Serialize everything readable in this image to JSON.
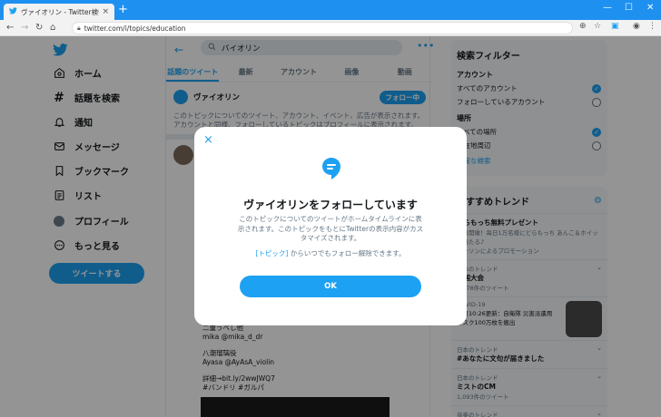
{
  "browser": {
    "tab_title": "ヴァイオリン - Twitter検索 / Twitter",
    "tab_close": "×",
    "new_tab": "+",
    "url": "twitter.com/i/topics/education",
    "window_controls": {
      "minimize": "—",
      "maximize": "☐",
      "close": "✕"
    }
  },
  "nav": {
    "items": [
      {
        "label": "ホーム",
        "icon": "home-icon"
      },
      {
        "label": "話題を検索",
        "icon": "hashtag-icon"
      },
      {
        "label": "通知",
        "icon": "bell-icon"
      },
      {
        "label": "メッセージ",
        "icon": "mail-icon"
      },
      {
        "label": "ブックマーク",
        "icon": "bookmark-icon"
      },
      {
        "label": "リスト",
        "icon": "list-icon"
      },
      {
        "label": "プロフィール",
        "icon": "avatar-icon"
      },
      {
        "label": "もっと見る",
        "icon": "more-icon"
      }
    ],
    "tweet_button": "ツイートする"
  },
  "header": {
    "search_value": "バイオリン",
    "tabs": [
      "話題のツイート",
      "最新",
      "アカウント",
      "画像",
      "動画"
    ]
  },
  "topic": {
    "name": "ヴァイオリン",
    "following": "フォロー中",
    "description": "このトピックについてのツイート、アカウント、イベント、広告が表示されます。アカウントと同様、フォローしているトピックはプロフィールに表示されます。"
  },
  "tweet": {
    "lines": [
      "二重うべし他",
      "mika @mika_d_dr",
      "",
      "八潮瑠璃役",
      "Ayasa @AyAsA_violin",
      "",
      "詳細→bit.ly/2wwJWQ7",
      "#バンドリ #ガルパ"
    ]
  },
  "filters": {
    "title": "検索フィルター",
    "account_label": "アカウント",
    "account_options": [
      {
        "label": "すべてのアカウント",
        "selected": true
      },
      {
        "label": "フォローしているアカウント",
        "selected": false
      }
    ],
    "location_label": "場所",
    "location_options": [
      {
        "label": "すべての場所",
        "selected": true
      },
      {
        "label": "現在地周辺",
        "selected": false
      }
    ],
    "advanced": "高度な検索"
  },
  "trends": {
    "title": "おすすめトレンド",
    "items": [
      {
        "meta": "",
        "name": "どらもっち無料プレゼント",
        "sub": "本日開催！毎日1万名様にどらもっち あんこ＆ホイップ当たる♪",
        "promo": "ローソンによるプロモーション"
      },
      {
        "meta": "日本のトレンド",
        "name": "全国大会",
        "sub": "1,078件のツイート"
      },
      {
        "meta": "COVID-19",
        "name": "",
        "sub": "今日10:26更新：自衛隊 災害派遣用マスク100万枚を搬出"
      },
      {
        "meta": "日本のトレンド",
        "name": "#あなたに文句が届きました",
        "sub": ""
      },
      {
        "meta": "日本のトレンド",
        "name": "ミストのCM",
        "sub": "1,093件のツイート"
      },
      {
        "meta": "音楽のトレンド",
        "name": "",
        "sub": ""
      }
    ]
  },
  "modal": {
    "title": "ヴァイオリンをフォローしています",
    "body": "このトピックについてのツイートがホームタイムラインに表示されます。このトピックをもとにTwitterの表示内容がカスタマイズされます。",
    "note_link": "[トピック]",
    "note_text": " からいつでもフォロー解除できます。",
    "ok": "OK",
    "close": "×"
  },
  "colors": {
    "accent": "#1da1f2",
    "browser_titlebar": "#1e90f0",
    "overlay": "rgba(0,0,0,0.42)"
  }
}
